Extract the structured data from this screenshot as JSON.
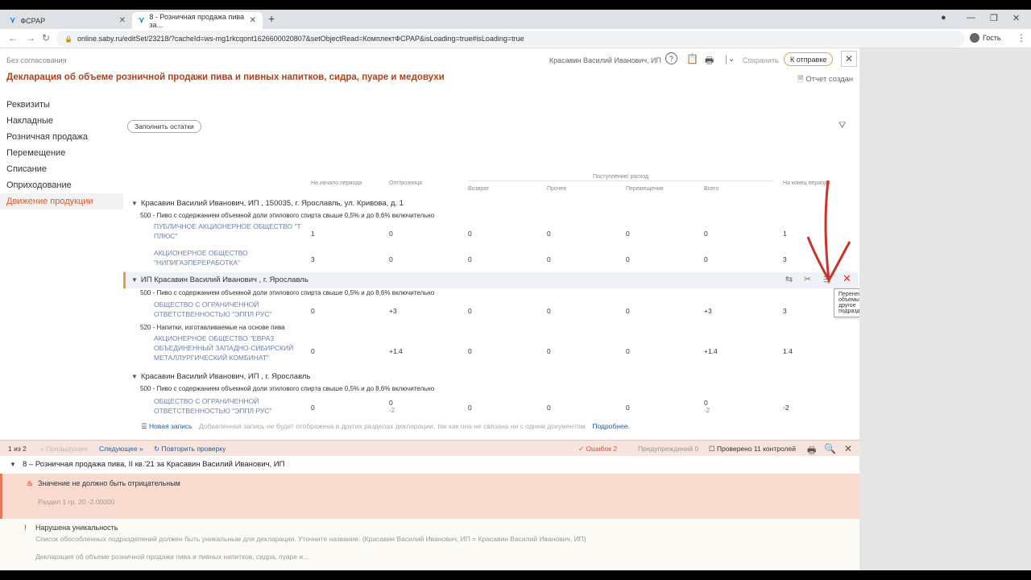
{
  "browser": {
    "tabs": [
      {
        "label": "ФСРАР",
        "active": false
      },
      {
        "label": "8 - Розничная продажа пива за...",
        "active": true
      }
    ],
    "url": "online.saby.ru/editSet/23218/?cacheId=ws-mg1rkcqont1626600020807&setObjectRead=КомплектФСРАР&isLoading=true#isLoading=true",
    "profile_label": "Гость"
  },
  "header": {
    "approval_status": "Без согласования",
    "title": "Декларация об объеме розничной продажи пива и пивных напитков, сидра, пуаре и медовухи",
    "org_name": "Красавин Василий Иванович, ИП",
    "save_label": "Сохранить",
    "send_label": "К отправке",
    "report_status": "Отчет создан"
  },
  "sidebar": {
    "items": [
      {
        "label": "Реквизиты",
        "active": false
      },
      {
        "label": "Накладные",
        "active": false
      },
      {
        "label": "Розничная продажа",
        "active": false
      },
      {
        "label": "Перемещение",
        "active": false
      },
      {
        "label": "Списание",
        "active": false
      },
      {
        "label": "Оприходование",
        "active": false
      },
      {
        "label": "Движение продукции",
        "active": true
      }
    ]
  },
  "table": {
    "fill_button": "Заполнить остатки",
    "columns": {
      "start": "На начало периода",
      "opt": "Опт/розница",
      "group": "Поступление/ расход",
      "return": "Возврат",
      "other": "Прочее",
      "move": "Перемещение",
      "total": "Всего",
      "end": "На конец периода"
    },
    "groups": [
      {
        "title": "Красавин Василий Иванович, ИП , 150035, г. Ярославль, ул. Кривова, д. 1",
        "subgroups": [
          {
            "code": "500 - Пиво с содержанием объемной доли этилового спирта свыше 0,5% и до 8,6% включительно",
            "rows": [
              {
                "org": [
                  "ПУБЛИЧНОЕ АКЦИОНЕРНОЕ ОБЩЕСТВО \"Т",
                  "ПЛЮС\""
                ],
                "start": "1",
                "opt": "0",
                "ret": "0",
                "other": "0",
                "move": "0",
                "total": "0",
                "end": "1"
              },
              {
                "org": [
                  "АКЦИОНЕРНОЕ ОБЩЕСТВО",
                  "\"НИПИГАЗПЕРЕРАБОТКА\""
                ],
                "start": "3",
                "opt": "0",
                "ret": "0",
                "other": "0",
                "move": "0",
                "total": "0",
                "end": "3"
              }
            ]
          }
        ]
      },
      {
        "title": "ИП Красавин Василий Иванович , г. Ярославль",
        "subgroups": [
          {
            "code": "500 - Пиво с содержанием объемной доли этилового спирта свыше 0,5% и до 8,6% включительно",
            "rows": [
              {
                "org": [
                  "ОБЩЕСТВО С ОГРАНИЧЕННОЙ",
                  "ОТВЕТСТВЕННОСТЬЮ \"ЭППЛ РУС\""
                ],
                "start": "0",
                "opt": "+3",
                "ret": "0",
                "other": "0",
                "move": "0",
                "total": "+3",
                "end": "3"
              }
            ]
          },
          {
            "code": "520 - Напитки, изготавливаемые на основе пива",
            "rows": [
              {
                "org": [
                  "АКЦИОНЕРНОЕ ОБЩЕСТВО \"ЕВРАЗ",
                  "ОБЪЕДИНЕННЫЙ ЗАПАДНО-СИБИРСКИЙ",
                  "МЕТАЛЛУРГИЧЕСКИЙ КОМБИНАТ\""
                ],
                "start": "0",
                "opt": "+1.4",
                "ret": "0",
                "other": "0",
                "move": "0",
                "total": "+1.4",
                "end": "1.4"
              }
            ]
          }
        ]
      },
      {
        "title": "Красавин Василий Иванович, ИП , г. Ярославль",
        "subgroups": [
          {
            "code": "500 - Пиво с содержанием объемной доли этилового спирта свыше 0,5% и до 8,6% включительно",
            "rows": [
              {
                "org": [
                  "ОБЩЕСТВО С ОГРАНИЧЕННОЙ",
                  "ОТВЕТСТВЕННОСТЬЮ \"ЭППЛ РУС\""
                ],
                "start": "0",
                "opt": "0",
                "opt_sub": "-2",
                "ret": "0",
                "other": "0",
                "move": "0",
                "total": "0",
                "total_sub": "-2",
                "end": "-2"
              }
            ]
          }
        ]
      }
    ],
    "tooltip": "Перенести все объемы в другое подразделение",
    "new_record": "Новая запись",
    "new_record_hint": "Добавленная запись не будет отображена в других разделах декларации, так как она не связана ни с одним документом.",
    "new_record_more": "Подробнее."
  },
  "errors": {
    "counter": "1 из 2",
    "prev": "Предыдущее",
    "next": "Следующее",
    "recheck": "Повторить проверку",
    "errors_count": "Ошибок 2",
    "warnings_count": "Предупреждений 0",
    "checked": "Проверено 11 контролей",
    "section_title": "8 – Розничная продажа пива, II кв.'21 за Красавин Василий Иванович, ИП",
    "items": [
      {
        "title": "Значение не должно быть отрицательным",
        "detail": "Раздел 1 гр. 20   -2.00000"
      },
      {
        "title": "Нарушена уникальность",
        "detail": "Список обособленных подразделений должен быть уникальным для декларации. Уточните название. (Красавин Василий Иванович, ИП = Красавин Василий Иванович, ИП)",
        "detail2": "Декларация об объеме розничной продажи пива и пивных напитков, сидра, пуаре и..."
      }
    ]
  },
  "colors": {
    "accent": "#b3411a",
    "active_nav": "#e05a2b",
    "arrow": "#c8342b",
    "link": "#1a5ea8"
  }
}
